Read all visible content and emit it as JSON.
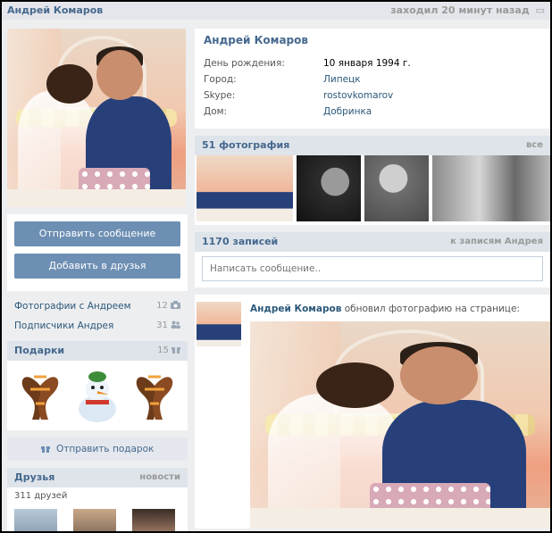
{
  "header": {
    "name": "Андрей Комаров",
    "status": "заходил 20 минут назад"
  },
  "profile": {
    "name": "Андрей Комаров",
    "fields": [
      {
        "label": "День рождения:",
        "value": "10 января 1994 г."
      },
      {
        "label": "Город:",
        "value": "Липецк"
      },
      {
        "label": "Skype:",
        "value": "rostovkomarov"
      },
      {
        "label": "Дом:",
        "value": "Добринка"
      }
    ]
  },
  "actions": {
    "message": "Отправить сообщение",
    "add_friend": "Добавить в друзья"
  },
  "links": [
    {
      "label": "Фотографии с Андреем",
      "count": "12"
    },
    {
      "label": "Подписчики Андрея",
      "count": "31"
    }
  ],
  "gifts": {
    "title": "Подарки",
    "count": "15",
    "send_label": "Отправить подарок"
  },
  "friends": {
    "title": "Друзья",
    "more": "новости",
    "count_text": "311 друзей"
  },
  "photos": {
    "title": "51 фотография",
    "more": "все"
  },
  "wall": {
    "title": "1170 записей",
    "more": "к записям Андрея",
    "placeholder": "Написать сообщение.."
  },
  "post": {
    "author": "Андрей Комаров",
    "action": "обновил фотографию на странице:"
  },
  "colors": {
    "accent": "#45688e",
    "button": "#6d8fb3",
    "link": "#2b587a",
    "header_bg": "#dee4ea"
  },
  "icons": {
    "camera": "camera-icon",
    "people": "people-icon",
    "gift": "gift-icon",
    "close": "close-icon"
  }
}
